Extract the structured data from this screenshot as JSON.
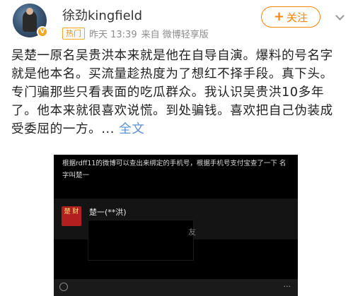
{
  "user": {
    "name": "徐劲kingfield",
    "vip_badge": "V"
  },
  "meta": {
    "tag": "热门",
    "time": "昨天 13:39",
    "source": "来自 微博轻享版"
  },
  "follow": {
    "icon": "+",
    "label": "关注"
  },
  "more_icon": "chevron-down-icon",
  "post": {
    "text": "吴楚一原名吴贵洪本来就是他在自导自演。爆料的号名字就是他本名。买流量趁热度为了想红不择手段。真下头。专门骗那些只看表面的吃瓜群众。我认识吴贵洪10多年了。他本来就很喜欢说慌。到处骗钱。喜欢把自己伪装成受委屈的一方。... ",
    "full_text_link": "全文"
  },
  "embed": {
    "caption": "根据rdff11的微博可以查出来绑定的手机号，根据手机号支付宝查了一下 名字叫楚一",
    "avatar_text": "楚\n财",
    "name": "楚一(**洪)",
    "friend_text": "友",
    "bar_dots": "···"
  },
  "colors": {
    "brand_orange": "#ff8200",
    "link_blue": "#5b8fd6",
    "hot_tag": "#f08a00"
  }
}
